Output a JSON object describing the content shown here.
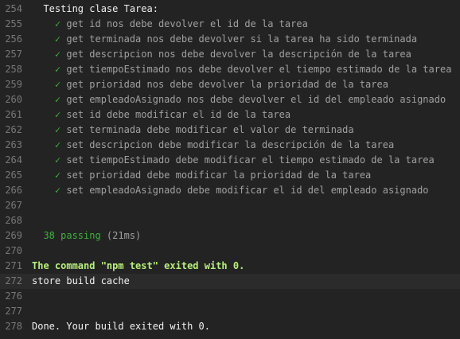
{
  "log": {
    "suite": {
      "line": "254",
      "indent": "  ",
      "title": "Testing clase Tarea:"
    },
    "tests": [
      {
        "line": "255",
        "indent": "    ",
        "check": "✓",
        "text": " get id nos debe devolver el id de la tarea"
      },
      {
        "line": "256",
        "indent": "    ",
        "check": "✓",
        "text": " get terminada nos debe devolver si la tarea ha sido terminada"
      },
      {
        "line": "257",
        "indent": "    ",
        "check": "✓",
        "text": " get descripcion nos debe devolver la descripción de la tarea"
      },
      {
        "line": "258",
        "indent": "    ",
        "check": "✓",
        "text": " get tiempoEstimado nos debe devolver el tiempo estimado de la tarea"
      },
      {
        "line": "259",
        "indent": "    ",
        "check": "✓",
        "text": " get prioridad nos debe devolver la prioridad de la tarea"
      },
      {
        "line": "260",
        "indent": "    ",
        "check": "✓",
        "text": " get empleadoAsignado nos debe devolver el id del empleado asignado"
      },
      {
        "line": "261",
        "indent": "    ",
        "check": "✓",
        "text": " set id debe modificar el id de la tarea"
      },
      {
        "line": "262",
        "indent": "    ",
        "check": "✓",
        "text": " set terminada debe modificar el valor de terminada"
      },
      {
        "line": "263",
        "indent": "    ",
        "check": "✓",
        "text": " set descripcion debe modificar la descripción de la tarea"
      },
      {
        "line": "264",
        "indent": "    ",
        "check": "✓",
        "text": " set tiempoEstimado debe modificar el tiempo estimado de la tarea"
      },
      {
        "line": "265",
        "indent": "    ",
        "check": "✓",
        "text": " set prioridad debe modificar la prioridad de la tarea"
      },
      {
        "line": "266",
        "indent": "    ",
        "check": "✓",
        "text": " set empleadoAsignado debe modificar el id del empleado asignado"
      }
    ],
    "blank1": {
      "line": "267"
    },
    "blank2": {
      "line": "268"
    },
    "summary": {
      "line": "269",
      "indent": "  ",
      "passing": "38 passing",
      "duration": " (21ms)"
    },
    "blank3": {
      "line": "270"
    },
    "exit": {
      "line": "271",
      "text": "The command \"npm test\" exited with 0."
    },
    "cache": {
      "line": "272",
      "text": "store build cache"
    },
    "blank4": {
      "line": "276"
    },
    "blank5": {
      "line": "277"
    },
    "done": {
      "line": "278",
      "text": "Done. Your build exited with 0."
    }
  },
  "colors": {
    "background": "#232323",
    "line_number": "#787878",
    "check": "#3ab23a",
    "test_text": "#a0a0a0",
    "exit_text": "#b7ef7a",
    "highlight_row": "#2b2b2b"
  }
}
